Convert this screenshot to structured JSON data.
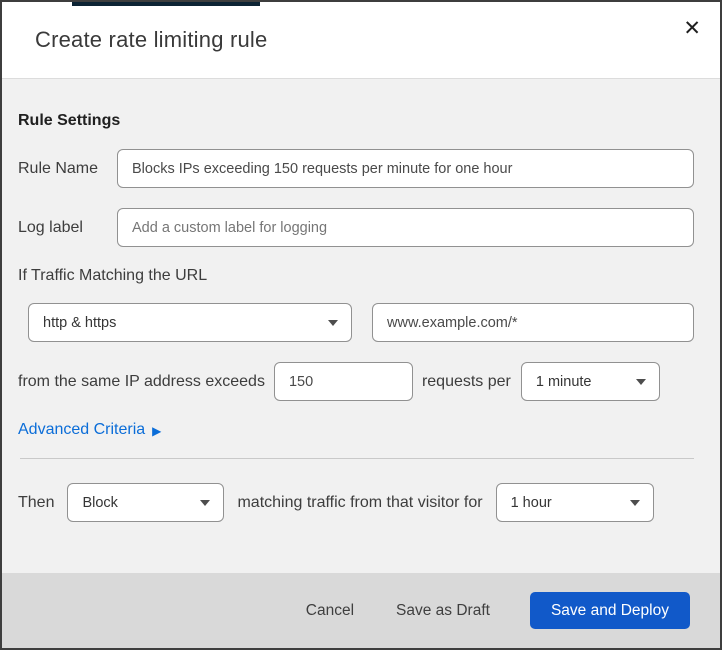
{
  "colors": {
    "primary_blue": "#1159c9",
    "link_blue": "#0b6dd8",
    "body_bg": "#f1f1f1",
    "footer_bg": "#d9d9d9"
  },
  "dialog": {
    "title": "Create rate limiting rule",
    "close_glyph": "✕"
  },
  "rule_settings": {
    "heading": "Rule Settings",
    "rule_name": {
      "label": "Rule Name",
      "value": "Blocks IPs exceeding 150 requests per minute for one hour"
    },
    "log_label": {
      "label": "Log label",
      "placeholder": "Add a custom label for logging"
    },
    "match": {
      "intro": "If Traffic Matching the URL",
      "scheme": {
        "value": "http & https"
      },
      "url": {
        "value": "www.example.com/*"
      }
    },
    "threshold": {
      "prefix": "from the same IP address exceeds",
      "requests": {
        "value": "150"
      },
      "unit_label": "requests per",
      "period": {
        "value": "1 minute"
      }
    },
    "advanced": {
      "label": "Advanced Criteria",
      "arrow_glyph": "▶"
    },
    "action": {
      "prefix": "Then",
      "action_select": {
        "value": "Block"
      },
      "middle": "matching traffic from that visitor for",
      "duration": {
        "value": "1 hour"
      }
    }
  },
  "footer": {
    "cancel": "Cancel",
    "save_draft": "Save as Draft",
    "save_deploy": "Save and Deploy"
  }
}
